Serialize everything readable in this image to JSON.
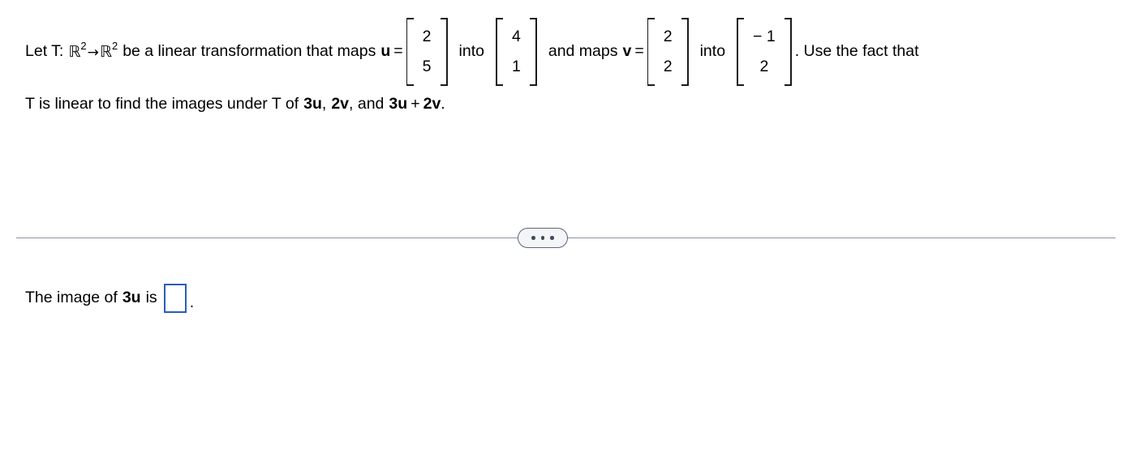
{
  "problem": {
    "line1": {
      "intro": "Let T:",
      "domain": {
        "symbol": "ℝ",
        "exponent": "2"
      },
      "arrow": "→",
      "codomain": {
        "symbol": "ℝ",
        "exponent": "2"
      },
      "after_codomain": "be a linear transformation that maps",
      "vector_u_label": "u",
      "equals_1": "=",
      "into_1": "into",
      "and_maps": "and maps",
      "vector_v_label": "v",
      "equals_2": "=",
      "into_2": "into",
      "tail": ". Use the fact that"
    },
    "line2": {
      "prefix": "T is linear to find the images under T of",
      "term1_coeff": "3",
      "term1_vec": "u",
      "comma1": ",",
      "term2_coeff": "2",
      "term2_vec": "v",
      "comma2": ", and",
      "term3a_coeff": "3",
      "term3a_vec": "u",
      "plus": "+",
      "term3b_coeff": "2",
      "term3b_vec": "v",
      "period": "."
    },
    "matrices": [
      {
        "name": "vector-u",
        "entries": [
          "2",
          "5"
        ]
      },
      {
        "name": "image-of-u",
        "entries": [
          "4",
          "1"
        ]
      },
      {
        "name": "vector-v",
        "entries": [
          "2",
          "2"
        ]
      },
      {
        "name": "image-of-v",
        "entries": [
          "− 1",
          "2"
        ]
      }
    ]
  },
  "divider": {
    "ellipsis_dots": 3,
    "line_color": "#8b92a6",
    "button_fill": "#f4f5f7",
    "button_border": "#5d6577"
  },
  "answer": {
    "prefix": "The image of",
    "coeff": "3",
    "vector": "u",
    "verb": "is",
    "input_value": "",
    "input_placeholder": "",
    "period": ".",
    "input_border_color": "#2b5cb8"
  }
}
